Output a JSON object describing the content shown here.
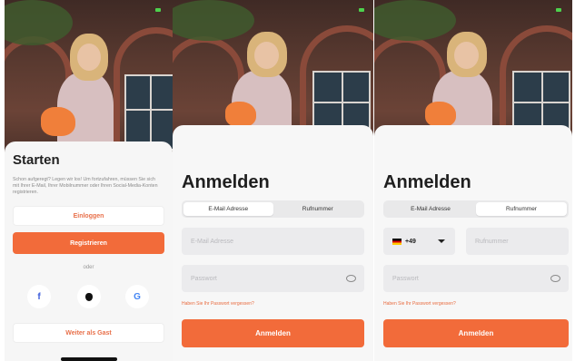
{
  "colors": {
    "accent": "#f26b3a",
    "sheet": "#f6f6f6",
    "field": "#ebebed"
  },
  "start_screen": {
    "title": "Starten",
    "intro": "Schon aufgeregt? Legen wir los! Um fortzufahren, müssen Sie sich mit Ihrer E-Mail, Ihrer Mobilnummer oder Ihren Social-Media-Konten registrieren.",
    "login_label": "Einloggen",
    "register_label": "Registrieren",
    "or_label": "oder",
    "social": [
      {
        "icon": "facebook-icon",
        "glyph": "f"
      },
      {
        "icon": "apple-icon",
        "glyph": ""
      },
      {
        "icon": "google-icon",
        "glyph": "G"
      }
    ],
    "guest_label": "Weiter als Gast"
  },
  "login_email": {
    "title": "Anmelden",
    "tabs": [
      "E-Mail Adresse",
      "Rufnummer"
    ],
    "active_tab": 0,
    "email_placeholder": "E-Mail Adresse",
    "password_placeholder": "Passwort",
    "forgot_label": "Haben Sie Ihr Passwort vergessen?",
    "submit_label": "Anmelden"
  },
  "login_phone": {
    "title": "Anmelden",
    "tabs": [
      "E-Mail Adresse",
      "Rufnummer"
    ],
    "active_tab": 1,
    "country_code": "+49",
    "country_flag": "germany-flag-icon",
    "phone_placeholder": "Rufnummer",
    "password_placeholder": "Passwort",
    "forgot_label": "Haben Sie Ihr Passwort vergessen?",
    "submit_label": "Anmelden"
  }
}
